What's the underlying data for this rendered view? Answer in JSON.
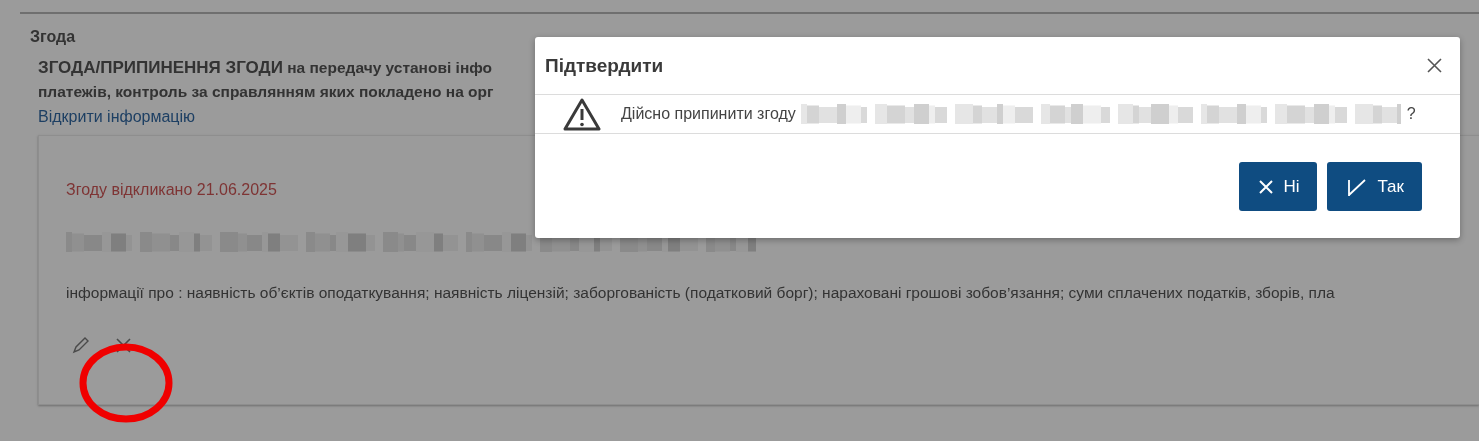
{
  "section": {
    "title": "Згода",
    "heading_lead": "ЗГОДА/ПРИПИНЕННЯ ЗГОДИ",
    "heading_lines": [
      " на передачу установі інфо",
      "платежів, контроль за справлянням яких покладено на орг"
    ],
    "link": "Відкрити інформацію"
  },
  "consent": {
    "status": "Згоду відкликано 21.06.2025",
    "info": "інформації про : наявність об’єктів оподаткування;  наявність ліцензій;  заборгованість (податковий борг);  нараховані грошові зобов’язання;  суми сплачених податків, зборів, пла",
    "actions": [
      {
        "kind": "edit"
      },
      {
        "kind": "revoke"
      }
    ]
  },
  "annotation": {
    "kind": "circle"
  },
  "dialog": {
    "title": "Підтвердити",
    "message": "Дійсно припинити згоду",
    "message_end": "?",
    "buttons": [
      {
        "kind": "cancel",
        "label": "Ні"
      },
      {
        "kind": "confirm",
        "label": "Так"
      }
    ]
  }
}
